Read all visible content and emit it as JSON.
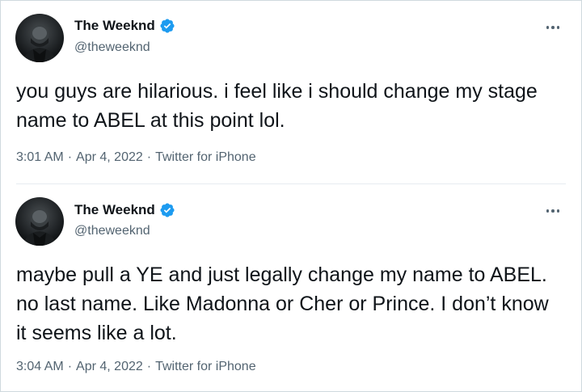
{
  "tweets": [
    {
      "author": {
        "display_name": "The Weeknd",
        "handle": "@theweeknd",
        "verified": true
      },
      "text": "you guys are hilarious. i feel like i should change my stage name to ABEL at this point lol.",
      "time": "3:01 AM",
      "date": "Apr 4, 2022",
      "source": "Twitter for iPhone",
      "separator": "·"
    },
    {
      "author": {
        "display_name": "The Weeknd",
        "handle": "@theweeknd",
        "verified": true
      },
      "text": "maybe pull a YE and just legally change my name to ABEL. no last name. Like Madonna or Cher or Prince. I don’t know it seems like a lot.",
      "time": "3:04 AM",
      "date": "Apr 4, 2022",
      "source": "Twitter for iPhone",
      "separator": "·"
    }
  ],
  "icons": {
    "verified": "verified-badge-icon",
    "more": "more-horizontal-icon"
  },
  "colors": {
    "verified_blue": "#1d9bf0",
    "text_primary": "#0f1419",
    "text_secondary": "#536471",
    "border": "#cfd9de"
  }
}
